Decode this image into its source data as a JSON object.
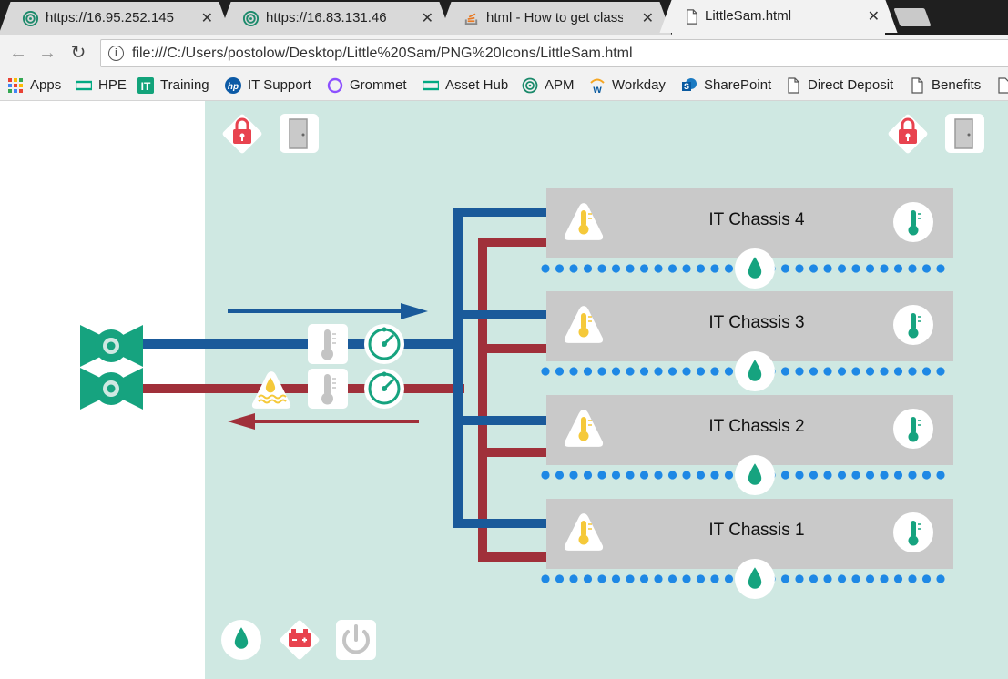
{
  "browser": {
    "tabs": [
      {
        "title": "https://16.95.252.145",
        "icon": "spiral-icon",
        "active": false
      },
      {
        "title": "https://16.83.131.46",
        "icon": "spiral-icon",
        "active": false
      },
      {
        "title": "html - How to get class n",
        "icon": "stack-overflow-icon",
        "active": false
      },
      {
        "title": "LittleSam.html",
        "icon": "page-icon",
        "active": true
      }
    ],
    "address": "file:///C:/Users/postolow/Desktop/Little%20Sam/PNG%20Icons/LittleSam.html",
    "bookmarks": [
      {
        "label": "Apps",
        "icon": "apps-grid-icon"
      },
      {
        "label": "HPE",
        "icon": "hpe-logo-icon"
      },
      {
        "label": "Training",
        "icon": "it-logo-icon"
      },
      {
        "label": "IT Support",
        "icon": "hp-logo-icon"
      },
      {
        "label": "Grommet",
        "icon": "grommet-ring-icon"
      },
      {
        "label": "Asset Hub",
        "icon": "hpe-logo-icon"
      },
      {
        "label": "APM",
        "icon": "spiral-icon"
      },
      {
        "label": "Workday",
        "icon": "workday-logo-icon"
      },
      {
        "label": "SharePoint",
        "icon": "sharepoint-logo-icon"
      },
      {
        "label": "Direct Deposit",
        "icon": "page-icon"
      },
      {
        "label": "Benefits",
        "icon": "page-icon"
      }
    ]
  },
  "dashboard": {
    "colors": {
      "background": "#cfe8e2",
      "supply_pipe": "#1a5a9a",
      "return_pipe": "#a0303a",
      "chassis": "#c9c9c9",
      "alert_red": "#e8434f",
      "green": "#1da383",
      "warning_yellow": "#f5c93a",
      "leak_dots": "#1e88e5"
    },
    "chassis": [
      {
        "label": "IT Chassis 4"
      },
      {
        "label": "IT Chassis 3"
      },
      {
        "label": "IT Chassis 2"
      },
      {
        "label": "IT Chassis 1"
      }
    ]
  }
}
